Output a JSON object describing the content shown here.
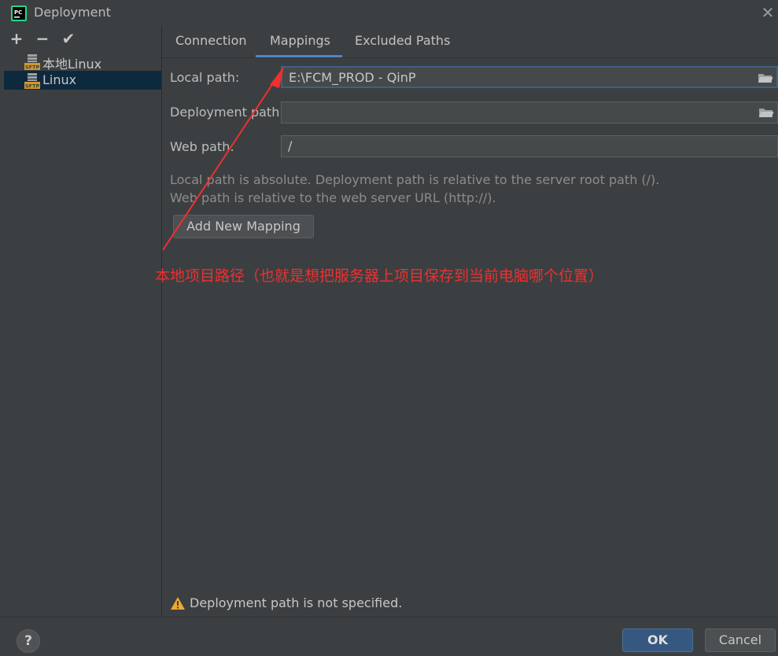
{
  "window": {
    "title": "Deployment",
    "app_icon": "pycharm-icon"
  },
  "toolbar": {
    "add_icon": "+",
    "remove_icon": "−",
    "apply_icon": "✔"
  },
  "servers": [
    {
      "label": "本地Linux",
      "icon": "sftp-icon",
      "selected": false
    },
    {
      "label": "Linux",
      "icon": "sftp-icon",
      "selected": true
    }
  ],
  "tabs": [
    {
      "label": "Connection",
      "active": false
    },
    {
      "label": "Mappings",
      "active": true
    },
    {
      "label": "Excluded Paths",
      "active": false
    }
  ],
  "fields": {
    "local_path": {
      "label": "Local path:",
      "value": "E:\\FCM_PROD - QinP"
    },
    "deployment_path": {
      "label": "Deployment path:",
      "value": ""
    },
    "web_path": {
      "label": "Web path:",
      "value": "/"
    }
  },
  "help": {
    "line1": "Local path is absolute. Deployment path is relative to the server root path (/).",
    "line2": "Web path is relative to the web server URL (http://)."
  },
  "add_mapping_label": "Add New Mapping",
  "annotation": "本地项目路径（也就是想把服务器上项目保存到当前电脑哪个位置）",
  "warning": "Deployment path is not specified.",
  "buttons": {
    "help": "?",
    "ok": "OK",
    "cancel": "Cancel"
  },
  "colors": {
    "background": "#3c3f41",
    "accent": "#4a88c7",
    "annotation": "#ee3030",
    "ok_button": "#365880"
  }
}
